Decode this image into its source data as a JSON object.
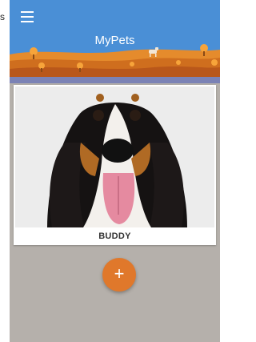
{
  "app": {
    "title": "MyPets"
  },
  "drawer_edge": {
    "glyph": "s"
  },
  "pets": [
    {
      "name": "BUDDY"
    }
  ],
  "fab": {
    "label": "+"
  },
  "colors": {
    "header": "#4a8fd6",
    "accent": "#e0782b",
    "background": "#b5b0ab"
  },
  "icons": {
    "menu": "hamburger-menu-icon",
    "add": "plus-icon"
  }
}
